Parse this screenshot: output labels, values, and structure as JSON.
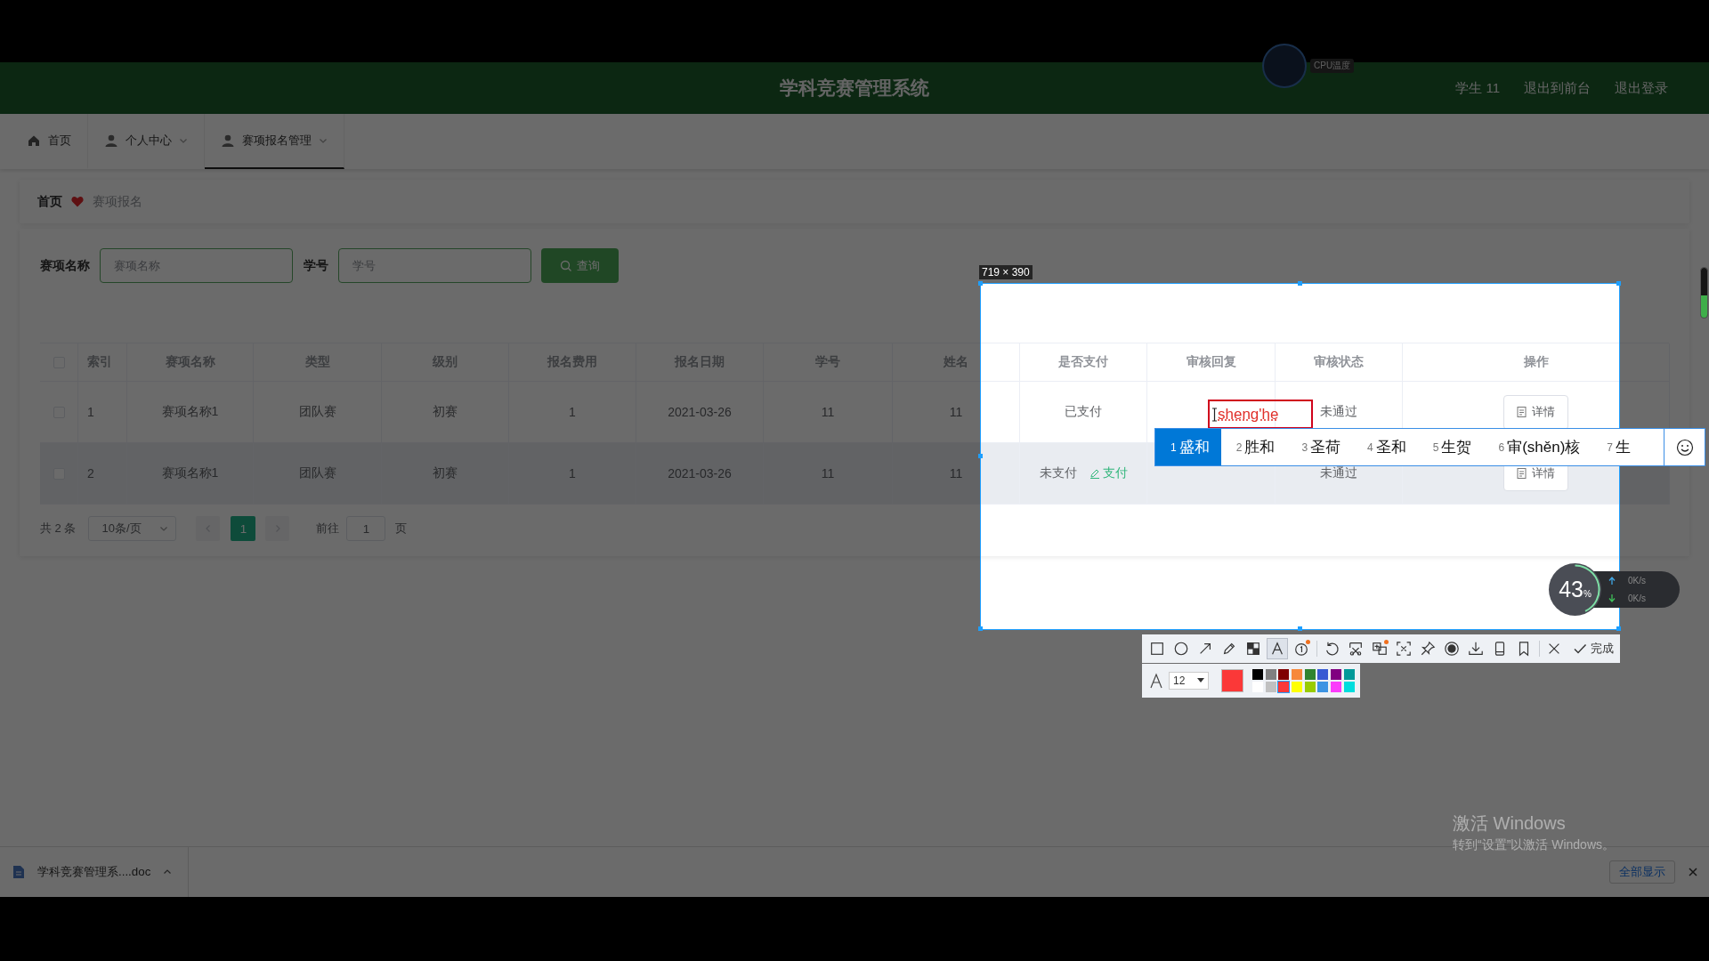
{
  "cpu_widget": {
    "label": "CPU温度"
  },
  "header": {
    "title": "学科竞赛管理系统",
    "links": [
      "学生 11",
      "退出到前台",
      "退出登录"
    ]
  },
  "nav_tabs": [
    {
      "label": "首页",
      "dropdown": false,
      "selected": false
    },
    {
      "label": "个人中心",
      "dropdown": true,
      "selected": false
    },
    {
      "label": "赛项报名管理",
      "dropdown": true,
      "selected": true
    }
  ],
  "breadcrumb": [
    "首页",
    "赛项报名"
  ],
  "search": {
    "fields": [
      {
        "label": "赛项名称",
        "placeholder": "赛项名称"
      },
      {
        "label": "学号",
        "placeholder": "学号"
      }
    ],
    "button": "查询"
  },
  "table": {
    "all_selected": false,
    "columns": [
      "索引",
      "赛项名称",
      "类型",
      "级别",
      "报名费用",
      "报名日期",
      "学号",
      "姓名",
      "是否支付",
      "审核回复",
      "审核状态",
      "操作"
    ],
    "rows": [
      {
        "selected": false,
        "highlighted": false,
        "index": "1",
        "event": "赛项名称1",
        "type": "团队赛",
        "level_name": "初赛",
        "fee": "1",
        "date": "2021-03-26",
        "student_id": "11",
        "name": "11",
        "payment": "已支付",
        "review_status": "未通过",
        "action": "详情"
      },
      {
        "selected": false,
        "highlighted": true,
        "index": "2",
        "event": "赛项名称1",
        "type": "团队赛",
        "level_name": "初赛",
        "fee": "1",
        "date": "2021-03-26",
        "student_id": "11",
        "name": "11",
        "payment": "未支付",
        "pay_link": "支付",
        "review_status": "未通过",
        "action": "详情"
      }
    ]
  },
  "pagination": {
    "total": "共 2 条",
    "page_size": "10条/页",
    "prev_disabled": true,
    "next_disabled": true,
    "pages": [
      {
        "label": "1",
        "selected": true
      }
    ],
    "goto_label": "前往",
    "goto_value": "1",
    "goto_suffix": "页"
  },
  "download_bar": {
    "file": "学科竞赛管理系....doc",
    "show_all": "全部显示"
  },
  "capture": {
    "size_label": "719 × 390",
    "text_box": {
      "value": "sheng'he"
    },
    "ime": {
      "candidates": [
        {
          "number": "1",
          "text": "盛和",
          "selected": true
        },
        {
          "number": "2",
          "text": "胜和",
          "selected": false
        },
        {
          "number": "3",
          "text": "圣荷",
          "selected": false
        },
        {
          "number": "4",
          "text": "圣和",
          "selected": false
        },
        {
          "number": "5",
          "text": "生贺",
          "selected": false
        },
        {
          "number": "6",
          "text": "审(shěn)核",
          "selected": false
        },
        {
          "number": "7",
          "text": "生",
          "selected": false
        }
      ]
    },
    "tool_groups": [
      [
        {
          "kind": "rect",
          "active": false,
          "badge": false
        },
        {
          "kind": "circle",
          "active": false,
          "badge": false
        },
        {
          "kind": "arrow",
          "active": false,
          "badge": false
        },
        {
          "kind": "pencil",
          "active": false,
          "badge": false
        },
        {
          "kind": "mosaic",
          "active": false,
          "badge": false
        },
        {
          "kind": "text",
          "active": true,
          "badge": false
        },
        {
          "kind": "number",
          "active": false,
          "badge": true
        }
      ],
      [
        {
          "kind": "undo",
          "active": false,
          "badge": false
        },
        {
          "kind": "cut",
          "active": false,
          "badge": false
        },
        {
          "kind": "translate",
          "active": false,
          "badge": true
        },
        {
          "kind": "scan",
          "active": false,
          "badge": false
        },
        {
          "kind": "pin",
          "active": false,
          "badge": false
        },
        {
          "kind": "record",
          "active": false,
          "badge": false
        },
        {
          "kind": "download",
          "active": false,
          "badge": false
        },
        {
          "kind": "phone",
          "active": false,
          "badge": false
        },
        {
          "kind": "bookmark",
          "active": false,
          "badge": false
        }
      ],
      [
        {
          "kind": "close",
          "active": false,
          "badge": false
        }
      ]
    ],
    "done": "完成",
    "palette": {
      "font_size": "12",
      "swatches": [
        {
          "color": "#000000",
          "selected": false
        },
        {
          "color": "#808080",
          "selected": false
        },
        {
          "color": "#800000",
          "selected": false
        },
        {
          "color": "#f7883a",
          "selected": false
        },
        {
          "color": "#308430",
          "selected": false
        },
        {
          "color": "#385ad3",
          "selected": false
        },
        {
          "color": "#800080",
          "selected": false
        },
        {
          "color": "#009999",
          "selected": false
        },
        {
          "color": "#ffffff",
          "selected": false
        },
        {
          "color": "#c0c0c0",
          "selected": false
        },
        {
          "color": "#fb3838",
          "selected": true
        },
        {
          "color": "#ffff00",
          "selected": false
        },
        {
          "color": "#99cc00",
          "selected": false
        },
        {
          "color": "#3d94e3",
          "selected": false
        },
        {
          "color": "#fb3bfb",
          "selected": false
        },
        {
          "color": "#00dddd",
          "selected": false
        }
      ]
    },
    "net_monitor": {
      "percent": "43",
      "unit": "%",
      "level": 0.43,
      "upload": "0K/s",
      "download": "0K/s"
    },
    "side_gauge": {
      "level": 0.45
    }
  },
  "watermark": {
    "title": "激活 Windows",
    "subtitle": "转到“设置”以激活 Windows。"
  }
}
